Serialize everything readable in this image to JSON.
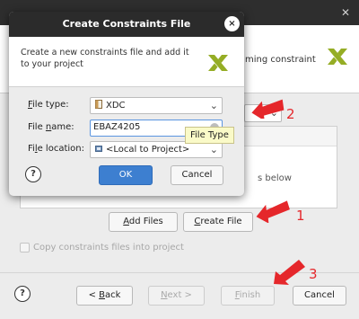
{
  "wizard": {
    "subtitle_fragment": "ming constraint",
    "list_hint_fragment": "s below",
    "buttons": {
      "add_files_prefix": "",
      "add_files_underline": "A",
      "add_files_rest": "dd Files",
      "create_file_prefix": "",
      "create_file_underline": "C",
      "create_file_rest": "reate File",
      "back_prefix": "< ",
      "back_underline": "B",
      "back_rest": "ack",
      "next_underline": "N",
      "next_rest": "ext >",
      "finish_underline": "F",
      "finish_rest": "inish",
      "cancel": "Cancel"
    },
    "copy_checkbox_label": "Copy constraints files into project",
    "copy_checked": false,
    "help": "?"
  },
  "dialog": {
    "title": "Create Constraints File",
    "close_glyph": "×",
    "description": "Create a new constraints file and add it to your project",
    "file_type_label_underline": "F",
    "file_type_label_rest": "ile type:",
    "file_type_value": "XDC",
    "file_name_label_prefix": "File ",
    "file_name_label_underline": "n",
    "file_name_label_rest": "ame:",
    "file_name_value": "EBAZ4205",
    "file_location_label_prefix": "Fi",
    "file_location_label_underline": "l",
    "file_location_label_rest": "e location:",
    "file_location_value": "<Local to Project>",
    "ok": "OK",
    "cancel": "Cancel",
    "help": "?"
  },
  "tooltip": "File Type",
  "annotations": [
    "1",
    "2",
    "3"
  ],
  "colors": {
    "accent": "#3d7fd0",
    "annotation": "#e5272b",
    "logo": "#95ad25",
    "titlebar": "#2b2b2b"
  },
  "icons": [
    "close-icon",
    "chevron-down-icon",
    "help-icon",
    "xilinx-logo",
    "file-icon",
    "folder-icon",
    "arrow-icon",
    "clear-icon"
  ]
}
